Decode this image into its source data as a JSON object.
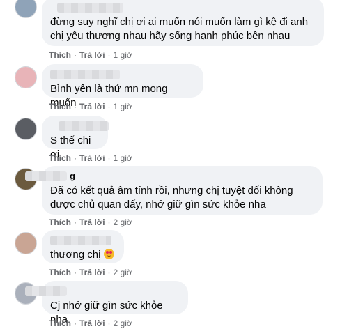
{
  "comments": [
    {
      "text": "đừng suy nghĩ chị ơi ai muốn nói muốn làm gì kệ đi anh\nchị yêu thương nhau hãy sống hạnh phúc bên nhau",
      "like_label": "Thích",
      "reply_label": "Trả lời",
      "time": "1 giờ",
      "avatar_color": "#8fa3b8"
    },
    {
      "text": "Bình yên là thứ mn mong muốn",
      "like_label": "Thích",
      "reply_label": "Trả lời",
      "time": "1 giờ",
      "avatar_color": "#e8b4b8"
    },
    {
      "text": "S thế chi ơi",
      "like_label": "Thích",
      "reply_label": "Trả lời",
      "time": "1 giờ",
      "avatar_color": "#5a5d63"
    },
    {
      "name_fragment": "g",
      "text": "Đã có kết quả âm tính rồi, nhưng chị tuyệt đối không\nđược chủ quan đấy, nhớ giữ gìn sức khỏe nha",
      "like_label": "Thích",
      "reply_label": "Trả lời",
      "time": "2 giờ",
      "avatar_color": "#6b5a3e"
    },
    {
      "text": "thương chị",
      "emoji": "heart-eyes-emoji",
      "like_label": "Thích",
      "reply_label": "Trả lời",
      "time": "2 giờ",
      "avatar_color": "#c9a594"
    },
    {
      "text": "Cj nhớ giữ gìn sức khỏe nha",
      "like_label": "Thích",
      "reply_label": "Trả lời",
      "time": "2 giờ",
      "avatar_color": "#aab0bb"
    }
  ]
}
